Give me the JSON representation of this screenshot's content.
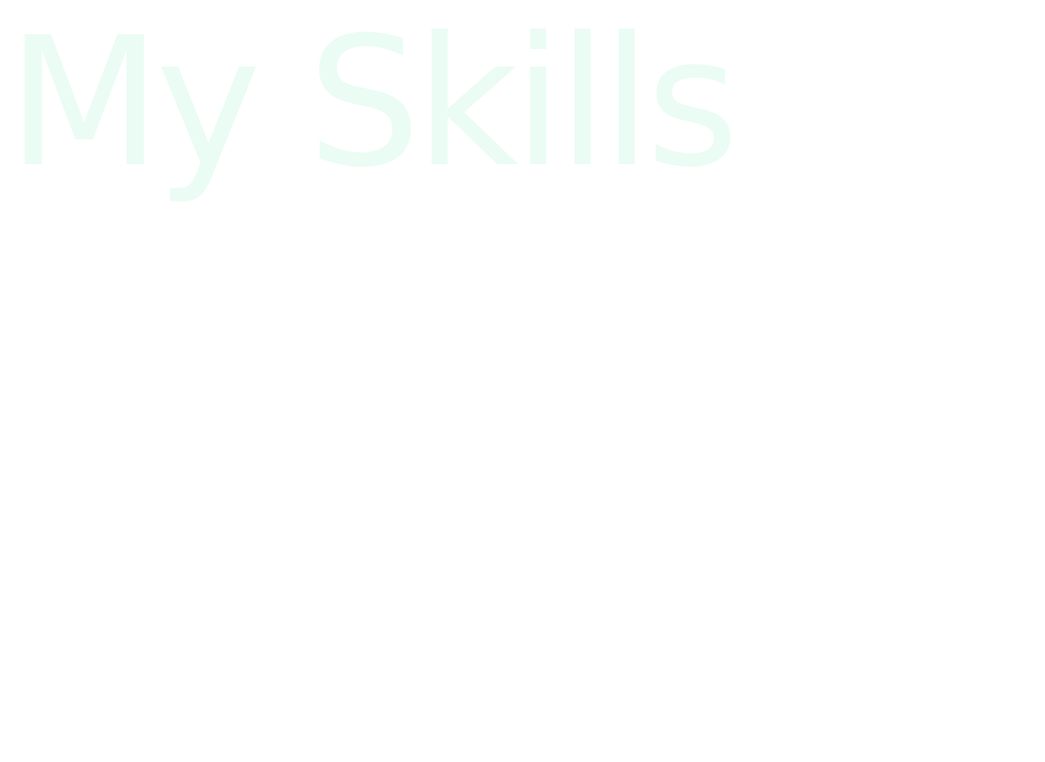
{
  "section": {
    "title": "My Skills"
  },
  "colors": {
    "background": "#ffffff",
    "title_text": "#eafcf4"
  }
}
